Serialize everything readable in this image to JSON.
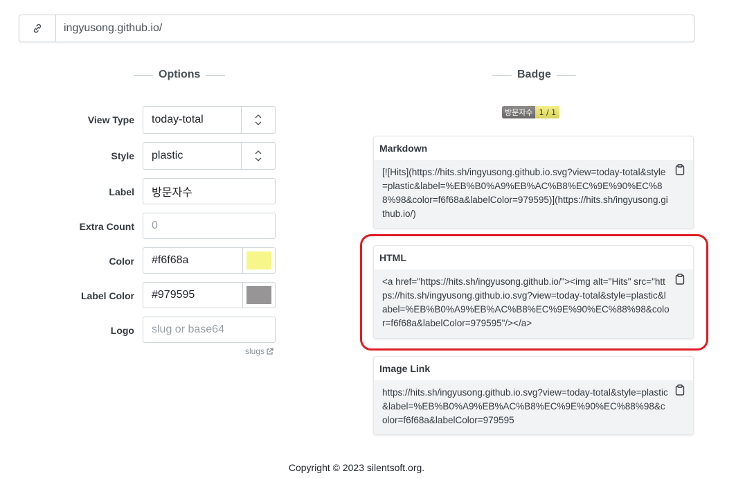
{
  "url_bar": {
    "value": "ingyusong.github.io/",
    "icon": "link-icon"
  },
  "options": {
    "title": "Options",
    "fields": {
      "view_type": {
        "label": "View Type",
        "value": "today-total"
      },
      "style": {
        "label": "Style",
        "value": "plastic"
      },
      "label": {
        "label": "Label",
        "value": "방문자수"
      },
      "extra_count": {
        "label": "Extra Count",
        "placeholder": "0"
      },
      "color": {
        "label": "Color",
        "value": "#f6f68a",
        "swatch": "#f6f68a"
      },
      "label_color": {
        "label": "Label Color",
        "value": "#979595",
        "swatch": "#979595"
      },
      "logo": {
        "label": "Logo",
        "placeholder": "slug or base64"
      }
    },
    "slugs_link": "slugs"
  },
  "badge_section": {
    "title": "Badge",
    "badge": {
      "label": "방문자수",
      "value": "1 / 1",
      "label_color": "#979595",
      "value_color": "#f6f68a"
    }
  },
  "cards": {
    "markdown": {
      "title": "Markdown",
      "code": "[![Hits](https://hits.sh/ingyusong.github.io.svg?view=today-total&style=plastic&label=%EB%B0%A9%EB%AC%B8%EC%9E%90%EC%88%98&color=f6f68a&labelColor=979595)](https://hits.sh/ingyusong.github.io/)"
    },
    "html": {
      "title": "HTML",
      "code": "<a href=\"https://hits.sh/ingyusong.github.io/\"><img alt=\"Hits\" src=\"https://hits.sh/ingyusong.github.io.svg?view=today-total&style=plastic&label=%EB%B0%A9%EB%AC%B8%EC%9E%90%EC%88%98&color=f6f68a&labelColor=979595\"/></a>"
    },
    "image_link": {
      "title": "Image Link",
      "code": "https://hits.sh/ingyusong.github.io.svg?view=today-total&style=plastic&label=%EB%B0%A9%EB%AC%B8%EC%9E%90%EC%88%98&color=f6f68a&labelColor=979595"
    }
  },
  "footer": {
    "text": "Copyright © 2023 silentsoft.org."
  },
  "colors": {
    "highlight": "#e01c24",
    "border": "#ced4da"
  }
}
